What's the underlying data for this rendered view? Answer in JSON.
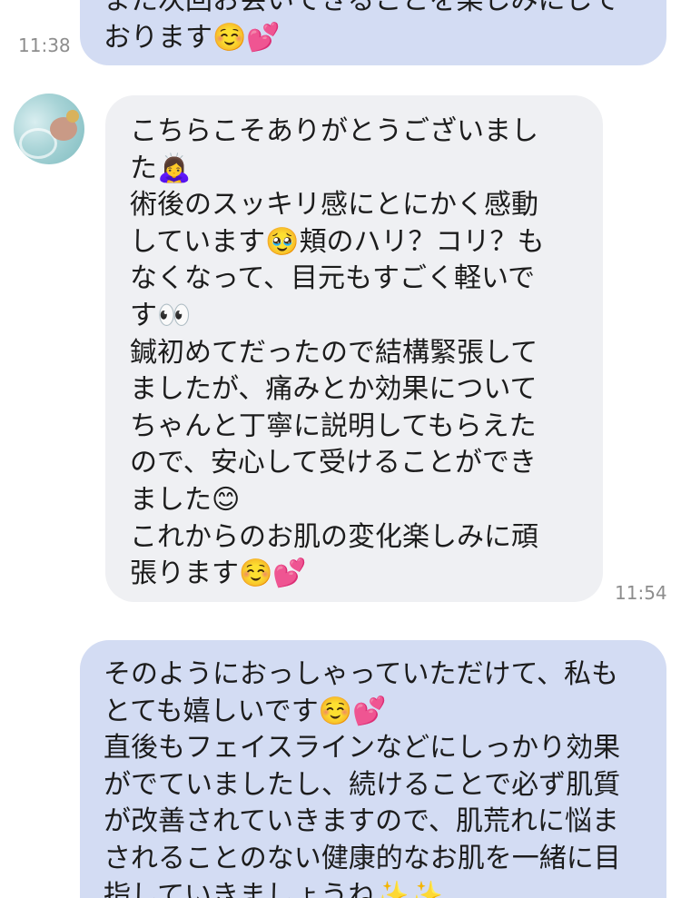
{
  "messages": [
    {
      "direction": "outgoing",
      "text": "また次回お会いできることを楽しみにして\nおります☺️💕",
      "time": "11:38"
    },
    {
      "direction": "incoming",
      "avatar_icon": "user-avatar-photo",
      "text": "こちらこそありがとうございまし\nた🙇‍♀️\n術後のスッキリ感にとにかく感動\nしています🥹頬のハリ？コリ？も\nなくなって、目元もすごく軽いで\nす👀\n鍼初めてだったので結構緊張して\nましたが、痛みとか効果について\nちゃんと丁寧に説明してもらえた\nので、安心して受けることができ\nました😊\nこれからのお肌の変化楽しみに頑\n張ります☺️💕",
      "time": "11:54"
    },
    {
      "direction": "outgoing",
      "text": "そのようにおっしゃっていただけて、私も\nとても嬉しいです☺️💕\n直後もフェイスラインなどにしっかり効果\nがでていましたし、続けることで必ず肌質\nが改善されていきますので、肌荒れに悩ま\nされることのない健康的なお肌を一緒に目\n指していきましょうね✨✨"
    }
  ],
  "colors": {
    "outgoing_bubble": "#d3dcf3",
    "incoming_bubble": "#eff0f3",
    "timestamp": "#8d8d8d",
    "text": "#1c1c1c"
  }
}
